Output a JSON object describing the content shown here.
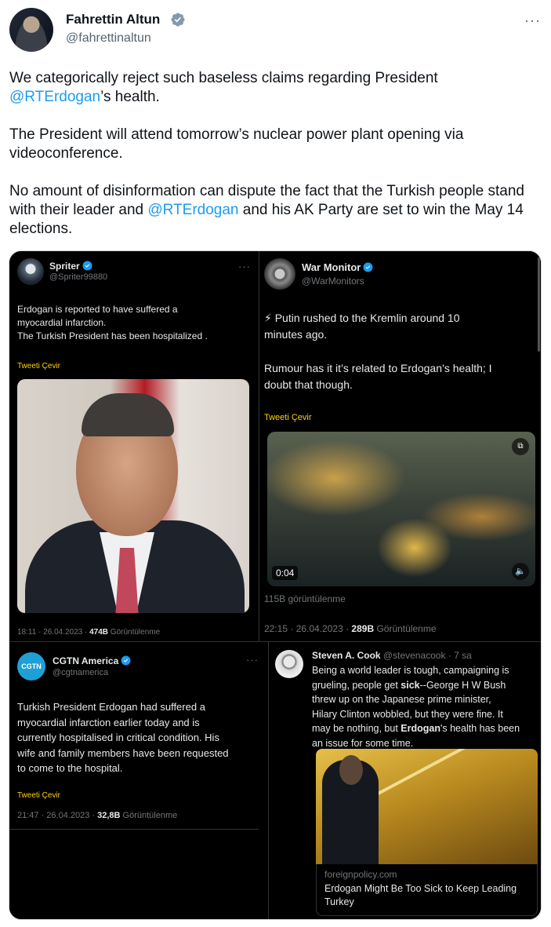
{
  "tweet": {
    "author": "Fahrettin Altun",
    "handle": "@fahrettinaltun",
    "more_icon": "more-dots-icon",
    "p1_a": "We categorically reject such baseless claims regarding President ",
    "p1_mention": "@RTErdogan",
    "p1_b": "’s health.",
    "p2": "The President will attend tomorrow’s nuclear power plant opening via videoconference.",
    "p3_a": "No amount of disinformation can dispute the fact that the Turkish people stand with their leader and ",
    "p3_mention": "@RTErdogan",
    "p3_b": " and his AK Party are set to win the May 14 elections."
  },
  "colors": {
    "mention": "#1d9bf0",
    "verified": "#1d9bf0",
    "translate": "#ffd400",
    "dark_bg": "#000000"
  },
  "media": {
    "spriter": {
      "name": "Spriter",
      "handle": "@Spriter99880",
      "text1": "Erdogan is reported to have suffered a",
      "text2": "myocardial infarction.",
      "text3": "The Turkish President has been hospitalized .",
      "translate": "Tweeti Çevir",
      "time": "18:11 · 26.04.2023 · ",
      "views_count": "474B",
      "views_label": " Görüntülenme"
    },
    "warmonitor": {
      "name": "War Monitor",
      "handle": "@WarMonitors",
      "text1": "⚡ Putin rushed to the Kremlin around 10",
      "text2": "minutes ago.",
      "text3": "Rumour has it it’s related to Erdogan’s health; I",
      "text4": "doubt that though.",
      "translate": "Tweeti Çevir",
      "video_time": "0:04",
      "video_views": "115B görüntülenme",
      "time": "22:15 · 26.04.2023 · ",
      "views_count": "289B",
      "views_label": " Görüntülenme"
    },
    "cgtn": {
      "name": "CGTN America",
      "handle": "@cgtnamerica",
      "logo": "CGTN",
      "text1": "Turkish President Erdogan had suffered a",
      "text2": "myocardial infarction earlier today and is",
      "text3": "currently hospitalised in critical condition. His",
      "text4": "wife and family members have been requested",
      "text5": "to come to the hospital.",
      "translate": "Tweeti Çevir",
      "time": "21:47 · 26.04.2023 · ",
      "views_count": "32,8B",
      "views_label": " Görüntülenme"
    },
    "cook": {
      "name": "Steven A. Cook",
      "handle_time": "@stevenacook · 7 sa",
      "text1": "Being a world leader is tough, campaigning is",
      "text2a": "grueling, people get ",
      "text2b": "sick",
      "text2c": "--George H W Bush",
      "text3": "threw up on the Japanese prime minister,",
      "text4": "Hilary Clinton wobbled, but they were fine. It",
      "text5a": "may be nothing, but ",
      "text5b": "Erdogan",
      "text5c": "'s health has been",
      "text6": "an issue for some time.",
      "card_domain": "foreignpolicy.com",
      "card_title1": "Erdogan Might Be Too Sick to Keep Leading",
      "card_title2": "Turkey"
    }
  }
}
